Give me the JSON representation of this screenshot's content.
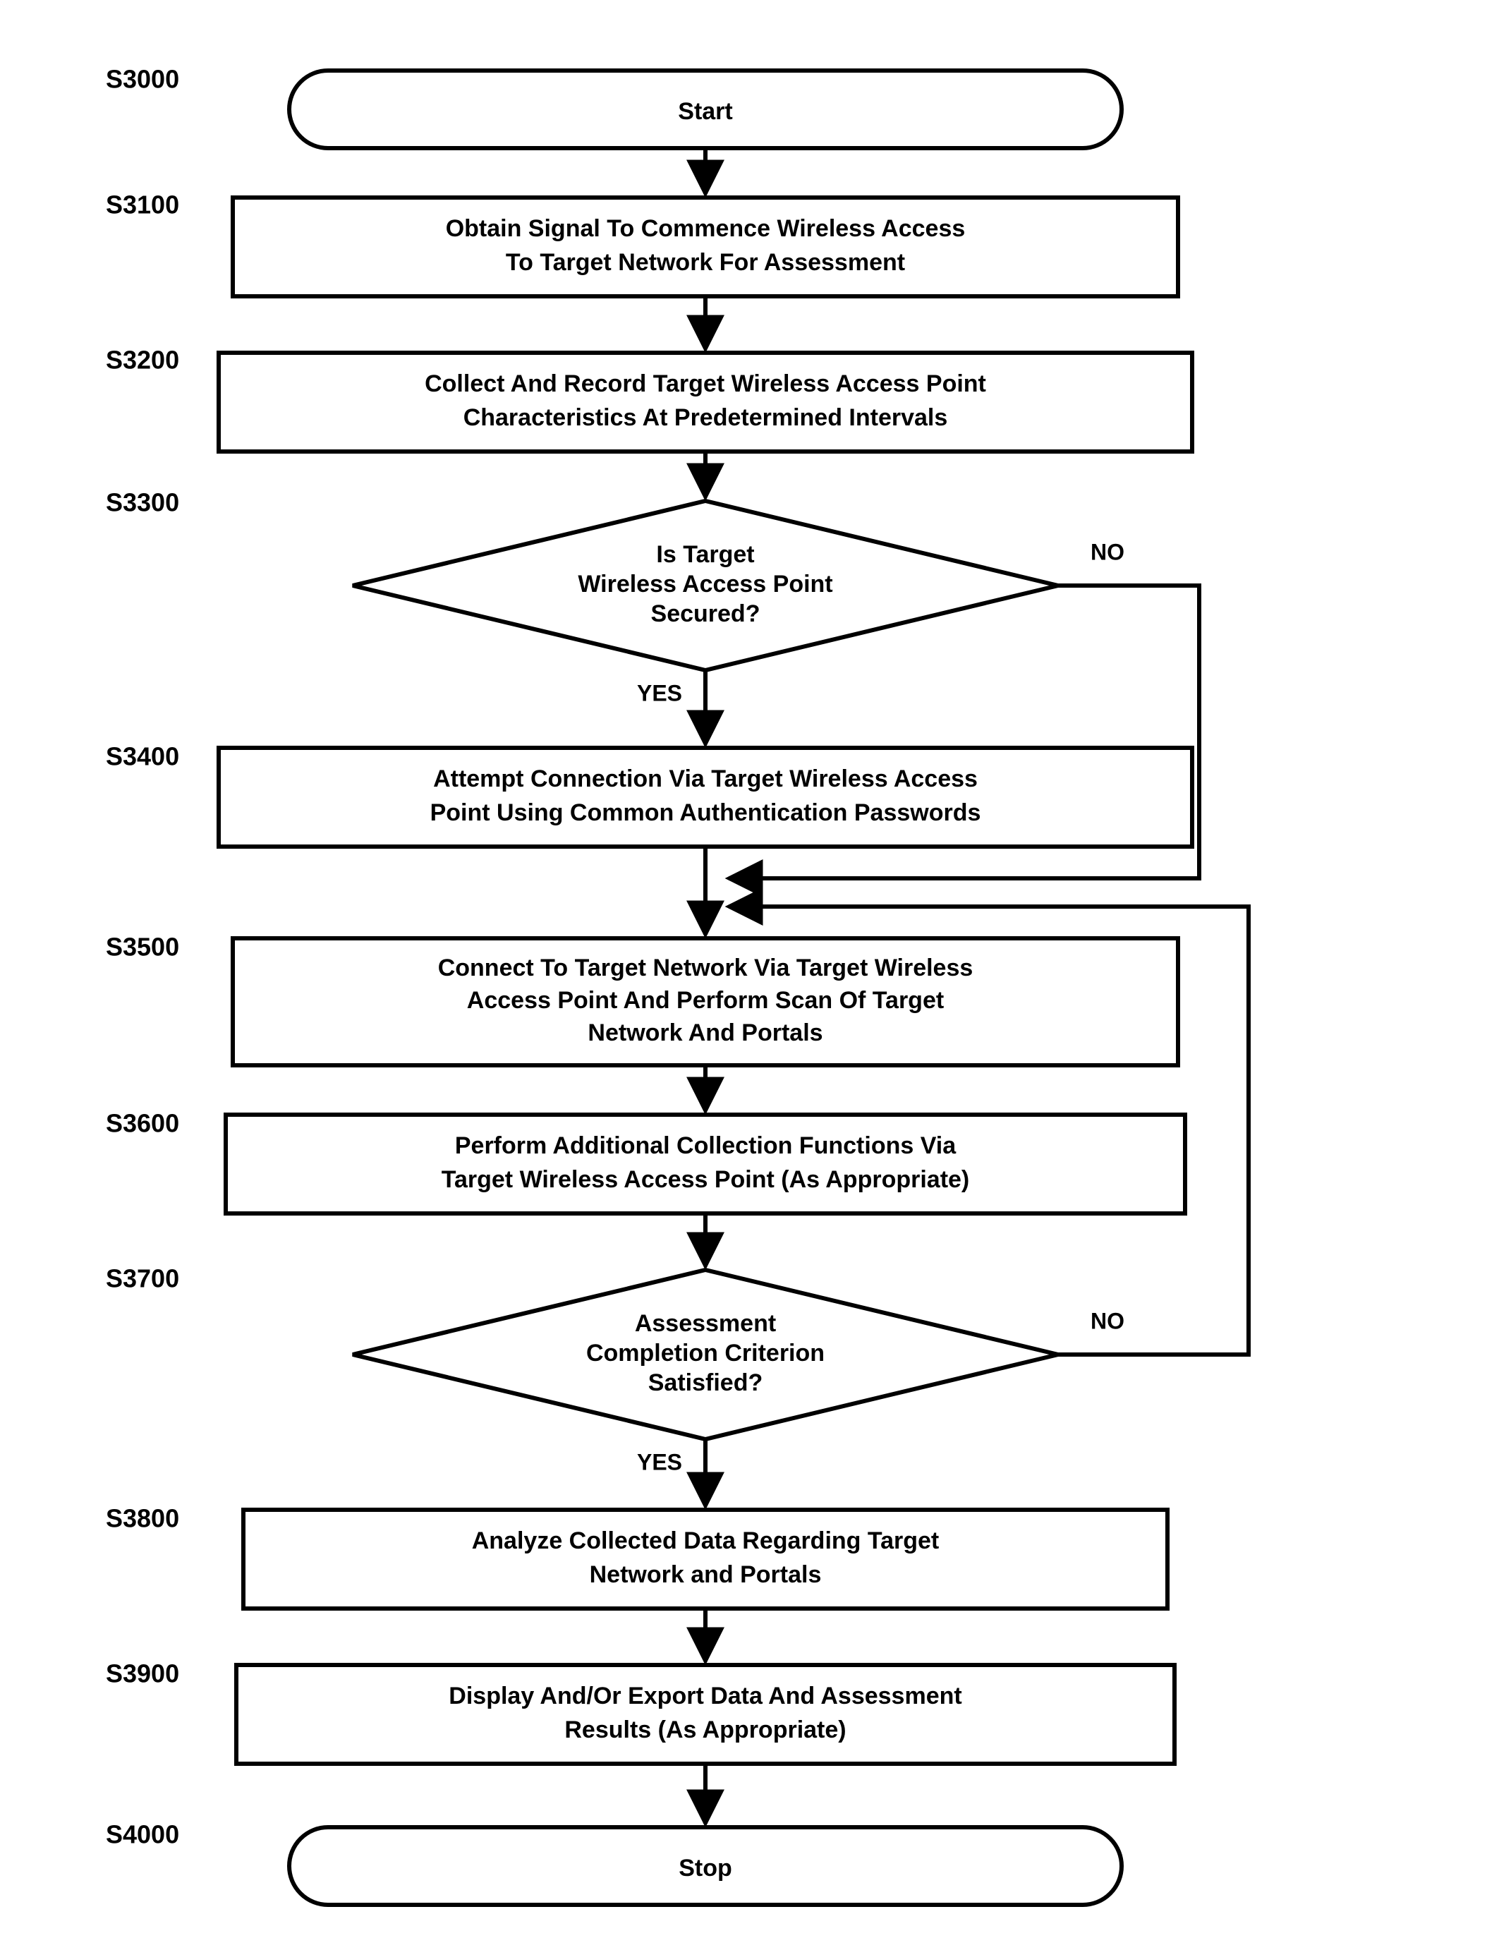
{
  "labels": {
    "s3000": "S3000",
    "s3100": "S3100",
    "s3200": "S3200",
    "s3300": "S3300",
    "s3400": "S3400",
    "s3500": "S3500",
    "s3600": "S3600",
    "s3700": "S3700",
    "s3800": "S3800",
    "s3900": "S3900",
    "s4000": "S4000"
  },
  "nodes": {
    "start": "Start",
    "s3100_l1": "Obtain Signal To Commence Wireless Access",
    "s3100_l2": "To Target Network For Assessment",
    "s3200_l1": "Collect And Record Target Wireless Access Point",
    "s3200_l2": "Characteristics At Predetermined Intervals",
    "s3300_l1": "Is Target",
    "s3300_l2": "Wireless Access Point",
    "s3300_l3": "Secured?",
    "s3400_l1": "Attempt Connection Via Target Wireless Access",
    "s3400_l2": "Point Using Common Authentication Passwords",
    "s3500_l1": "Connect To Target Network Via Target Wireless",
    "s3500_l2": "Access Point And Perform Scan Of Target",
    "s3500_l3": "Network And Portals",
    "s3600_l1": "Perform Additional Collection Functions Via",
    "s3600_l2": "Target Wireless Access Point (As Appropriate)",
    "s3700_l1": "Assessment",
    "s3700_l2": "Completion Criterion",
    "s3700_l3": "Satisfied?",
    "s3800_l1": "Analyze Collected Data Regarding Target",
    "s3800_l2": "Network and Portals",
    "s3900_l1": "Display And/Or Export Data And Assessment",
    "s3900_l2": "Results (As Appropriate)",
    "stop": "Stop"
  },
  "branches": {
    "yes": "YES",
    "no": "NO"
  }
}
